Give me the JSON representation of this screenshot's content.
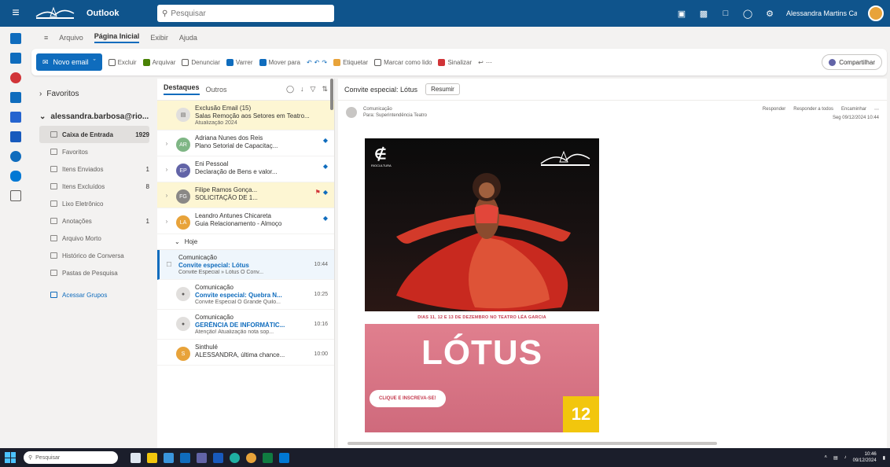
{
  "topbar": {
    "app_name": "Outlook",
    "search_placeholder": "Pesquisar",
    "user_name": "Alessandra Martins Ca..."
  },
  "ribbon_tabs": [
    "Arquivo",
    "Página Inicial",
    "Exibir",
    "Ajuda"
  ],
  "ribbon": {
    "new_mail": "Novo email",
    "buttons": [
      "Excluir",
      "Arquivar",
      "Denunciar",
      "Varrer",
      "Mover para",
      "Etiquetar",
      "Marcar como lido",
      "Sinalizar"
    ],
    "share_button": "Compartilhar"
  },
  "folders": {
    "favorites": "Favoritos",
    "account": "alessandra.barbosa@rio...",
    "items": [
      {
        "label": "Caixa de Entrada",
        "count": "1929",
        "selected": true
      },
      {
        "label": "Favoritos",
        "count": ""
      },
      {
        "label": "Itens Enviados",
        "count": "1"
      },
      {
        "label": "Itens Excluídos",
        "count": "8"
      },
      {
        "label": "Lixo Eletrônico",
        "count": ""
      },
      {
        "label": "Anotações",
        "count": "1"
      },
      {
        "label": "Arquivo Morto",
        "count": ""
      },
      {
        "label": "Histórico de Conversa",
        "count": ""
      },
      {
        "label": "Pastas de Pesquisa",
        "count": ""
      }
    ],
    "add_group": "Acessar Grupos"
  },
  "list": {
    "tab_focused": "Destaques",
    "tab_other": "Outros",
    "group_today": "Hoje",
    "pinned": [
      {
        "sender": "Exclusão Email (15)",
        "subject": "Salas Remoção aos Setores em Teatro...",
        "preview": "Atualização 2024",
        "initials": "",
        "avatar_color": "#e1dfdd",
        "highlight": true,
        "icons": ""
      },
      {
        "sender": "Adriana Nunes dos Reis",
        "subject": "Plano Setorial de Capacitaç...",
        "preview": "",
        "initials": "AR",
        "avatar_color": "#7fb685",
        "highlight": false,
        "icons": "pin"
      },
      {
        "sender": "Eni Pessoal",
        "subject": "Declaração de Bens e valor...",
        "preview": "",
        "initials": "EP",
        "avatar_color": "#6264a7",
        "highlight": false,
        "icons": "pin"
      },
      {
        "sender": "Filipe Ramos Gonça...",
        "subject": "SOLICITAÇÃO DE 1...",
        "preview": "",
        "initials": "FG",
        "avatar_color": "#8a8886",
        "highlight": true,
        "icons": "flag-pin"
      },
      {
        "sender": "Leandro Antunes Chicareta",
        "subject": "Guia Relacionamento - Almoço",
        "preview": "",
        "initials": "LA",
        "avatar_color": "#e8a33a",
        "highlight": false,
        "icons": "pin"
      }
    ],
    "today": [
      {
        "sender": "Comunicação",
        "subject": "Convite especial: Lótus",
        "time": "10:44",
        "preview": "Convite Especial » Lótus O Conv...",
        "initials": "",
        "avatar_color": "#e1dfdd",
        "selected": true
      },
      {
        "sender": "Comunicação",
        "subject": "Convite especial: Quebra N...",
        "time": "10:25",
        "preview": "Convite Especial O Grande Quilo...",
        "initials": "",
        "avatar_color": "#e1dfdd",
        "selected": false
      },
      {
        "sender": "Comunicação",
        "subject": "GERÊNCIA DE INFORMÁTIC...",
        "time": "10:16",
        "preview": "Atenção! Atualização nota sop...",
        "initials": "",
        "avatar_color": "#e1dfdd",
        "selected": false
      },
      {
        "sender": "Sinthulé",
        "subject": "ALESSANDRA, última chance...",
        "time": "10:00",
        "preview": "",
        "initials": "S",
        "avatar_color": "#e8a33a",
        "selected": false
      }
    ]
  },
  "reading": {
    "title": "Convite especial: Lótus",
    "summarize": "Resumir",
    "sender": "Comunicação",
    "to": "Para: Superintendência Teatro",
    "actions": [
      "Responder",
      "Responder a todos",
      "Encaminhar"
    ],
    "date": "Seg 09/12/2024 10:44",
    "poster": {
      "org_label": "RIOCULTURA",
      "date_line": "DIAS 11, 12 E 13 DE DEZEMBRO NO TEATRO LÉA GARCIA",
      "title": "LÓTUS",
      "cta": "CLIQUE E INSCREVA-SE!",
      "number": "12",
      "colors": {
        "photo_bg": "#0b0b0b",
        "banner": "#d9707f",
        "badge": "#f2c60d"
      }
    }
  },
  "taskbar": {
    "search_placeholder": "Pesquisar",
    "time": "10:46",
    "date": "09/12/2024"
  }
}
